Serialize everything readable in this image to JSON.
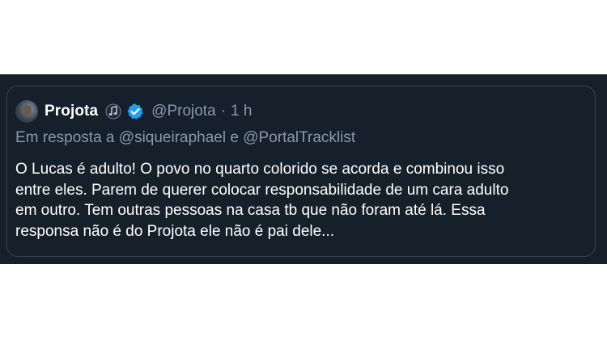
{
  "tweet": {
    "author": {
      "display_name": "Projota",
      "handle": "@Projota",
      "badge_icons": [
        "music-note-icon",
        "verified-badge-icon"
      ],
      "avatar": "avatar"
    },
    "separator": "·",
    "time": "1 h",
    "reply_to": "Em resposta a @siqueiraphael e @PortalTracklist",
    "text_lines": [
      "O Lucas é adulto! O povo no quarto colorido se acorda e combinou isso",
      "entre eles. Parem de querer colocar responsabilidade de um cara adulto",
      "em outro. Tem outras pessoas na casa tb que não foram até lá. Essa",
      "responsa não é do Projota ele não é pai dele..."
    ]
  },
  "colors": {
    "background": "#15202b",
    "page_background": "#ffffff",
    "border": "#38444d",
    "primary_text": "#ffffff",
    "secondary_text": "#8899a6",
    "verified_blue": "#1da1f2"
  }
}
